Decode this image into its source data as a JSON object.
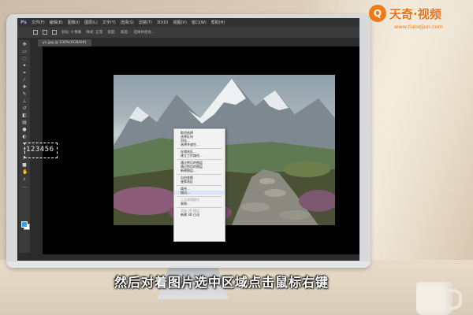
{
  "menubar": {
    "app_icon": "Ps",
    "items": [
      "文件(F)",
      "编辑(E)",
      "图像(I)",
      "图层(L)",
      "文字(Y)",
      "选择(S)",
      "滤镜(T)",
      "3D(D)",
      "视图(V)",
      "窗口(W)",
      "帮助(H)"
    ]
  },
  "options_bar": {
    "feather": "羽化: 0 像素",
    "style": "样式: 正常",
    "width": "宽度:",
    "height": "高度:",
    "select_mask": "选择并遮住..."
  },
  "document_tab": "yn.jpg @ 100%(RGB/8#)",
  "canvas_text": "123456",
  "context_menu": {
    "items": [
      {
        "label": "取消选择",
        "state": "normal"
      },
      {
        "label": "选择反向",
        "state": "normal"
      },
      {
        "label": "羽化...",
        "state": "normal"
      },
      {
        "label": "选择并遮住...",
        "state": "normal"
      },
      {
        "sep": true
      },
      {
        "label": "存储选区...",
        "state": "normal"
      },
      {
        "label": "建立工作路径...",
        "state": "normal"
      },
      {
        "sep": true
      },
      {
        "label": "通过拷贝的图层",
        "state": "normal"
      },
      {
        "label": "通过剪切的图层",
        "state": "normal"
      },
      {
        "label": "新建图层...",
        "state": "normal"
      },
      {
        "sep": true
      },
      {
        "label": "自由变换",
        "state": "normal"
      },
      {
        "label": "变换选区",
        "state": "normal"
      },
      {
        "sep": true
      },
      {
        "label": "填充...",
        "state": "normal"
      },
      {
        "label": "描边...",
        "state": "highlighted"
      },
      {
        "sep": true
      },
      {
        "label": "上次滤镜操作",
        "state": "disabled"
      },
      {
        "label": "渐隐...",
        "state": "normal"
      },
      {
        "sep": true
      },
      {
        "label": "渲染 3D 图层",
        "state": "disabled"
      },
      {
        "label": "新建 3D 凸出",
        "state": "normal"
      }
    ]
  },
  "caption": "然后对着图片选中区域点击鼠标右键",
  "brand": {
    "logo_glyph": "Q",
    "name": "天奇·视频",
    "url": "www.tianqijun.com"
  },
  "colors": {
    "accent_orange": "#f07a1a",
    "foreground_swatch": "#2ea8ff",
    "background_swatch": "#ffffff",
    "menu_highlight": "#d6e4f5"
  }
}
